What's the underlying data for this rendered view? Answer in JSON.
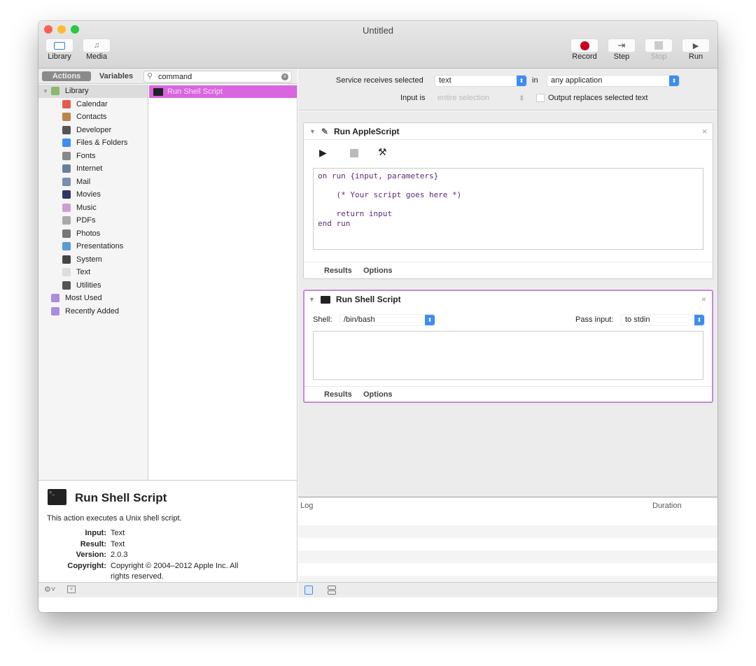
{
  "window": {
    "title": "Untitled"
  },
  "toolbar": {
    "library": "Library",
    "media": "Media",
    "record": "Record",
    "step": "Step",
    "stop": "Stop",
    "run": "Run"
  },
  "left": {
    "tab_actions": "Actions",
    "tab_variables": "Variables",
    "search_value": "command",
    "library_items": [
      {
        "label": "Library",
        "color": "#8bb86b"
      },
      {
        "label": "Calendar",
        "color": "#e35d4f"
      },
      {
        "label": "Contacts",
        "color": "#b8864b"
      },
      {
        "label": "Developer",
        "color": "#555555"
      },
      {
        "label": "Files & Folders",
        "color": "#3d8cf3"
      },
      {
        "label": "Fonts",
        "color": "#888888"
      },
      {
        "label": "Internet",
        "color": "#6a7fa0"
      },
      {
        "label": "Mail",
        "color": "#7a8fb0"
      },
      {
        "label": "Movies",
        "color": "#333366"
      },
      {
        "label": "Music",
        "color": "#c9a0d0"
      },
      {
        "label": "PDFs",
        "color": "#aaaaaa"
      },
      {
        "label": "Photos",
        "color": "#777777"
      },
      {
        "label": "Presentations",
        "color": "#5a9ad6"
      },
      {
        "label": "System",
        "color": "#444444"
      },
      {
        "label": "Text",
        "color": "#dddddd"
      },
      {
        "label": "Utilities",
        "color": "#555555"
      },
      {
        "label": "Most Used",
        "color": "#a98de0"
      },
      {
        "label": "Recently Added",
        "color": "#a98de0"
      }
    ],
    "result_item": "Run Shell Script"
  },
  "description": {
    "title": "Run Shell Script",
    "summary": "This action executes a Unix shell script.",
    "rows": [
      {
        "k": "Input:",
        "v": "Text"
      },
      {
        "k": "Result:",
        "v": "Text"
      },
      {
        "k": "Version:",
        "v": "2.0.3"
      },
      {
        "k": "Copyright:",
        "v": "Copyright © 2004–2012 Apple Inc.  All rights reserved."
      }
    ]
  },
  "header": {
    "receives_label": "Service receives selected",
    "receives_value": "text",
    "in_label": "in",
    "app_value": "any application",
    "input_is_label": "Input is",
    "input_is_value": "entire selection",
    "output_replaces": "Output replaces selected text"
  },
  "applescript": {
    "title": "Run AppleScript",
    "code": "on run {input, parameters}\n\n    (* Your script goes here *)\n\n    return input\nend run",
    "results": "Results",
    "options": "Options"
  },
  "shell": {
    "title": "Run Shell Script",
    "shell_label": "Shell:",
    "shell_value": "/bin/bash",
    "pass_label": "Pass input:",
    "pass_value": "to stdin",
    "results": "Results",
    "options": "Options"
  },
  "log": {
    "col_log": "Log",
    "col_duration": "Duration"
  },
  "colors": {
    "selection": "#d966e0",
    "accent": "#3d8cf3",
    "record": "#c8001a"
  }
}
